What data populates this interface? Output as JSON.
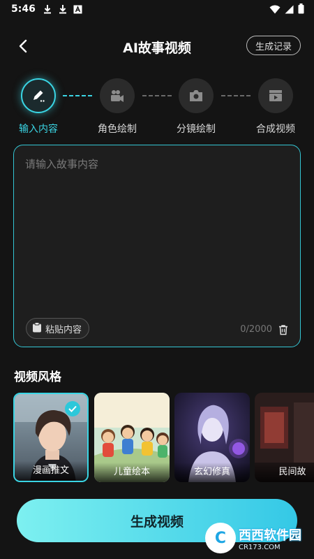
{
  "status_bar": {
    "time": "5:46"
  },
  "header": {
    "title": "AI故事视频",
    "records_label": "生成记录"
  },
  "steps": [
    {
      "label": "输入内容",
      "icon": "pencil-icon",
      "active": true
    },
    {
      "label": "角色绘制",
      "icon": "video-camera-icon",
      "active": false
    },
    {
      "label": "分镜绘制",
      "icon": "camera-icon",
      "active": false
    },
    {
      "label": "合成视频",
      "icon": "clapperboard-icon",
      "active": false
    }
  ],
  "input": {
    "placeholder": "请输入故事内容",
    "value": "",
    "paste_label": "粘贴内容",
    "counter": "0/2000"
  },
  "styles_section": {
    "title": "视频风格",
    "items": [
      {
        "label": "漫画推文",
        "selected": true
      },
      {
        "label": "儿童绘本",
        "selected": false
      },
      {
        "label": "玄幻修真",
        "selected": false
      },
      {
        "label": "民间故",
        "selected": false
      }
    ]
  },
  "generate_button": {
    "label": "生成视频"
  },
  "watermark": {
    "main": "西西软件园",
    "sub": "CR173.COM"
  },
  "colors": {
    "accent": "#3ad5e4",
    "background": "#141414",
    "button_gradient_start": "#7df0f0",
    "button_gradient_end": "#34c8e6"
  }
}
